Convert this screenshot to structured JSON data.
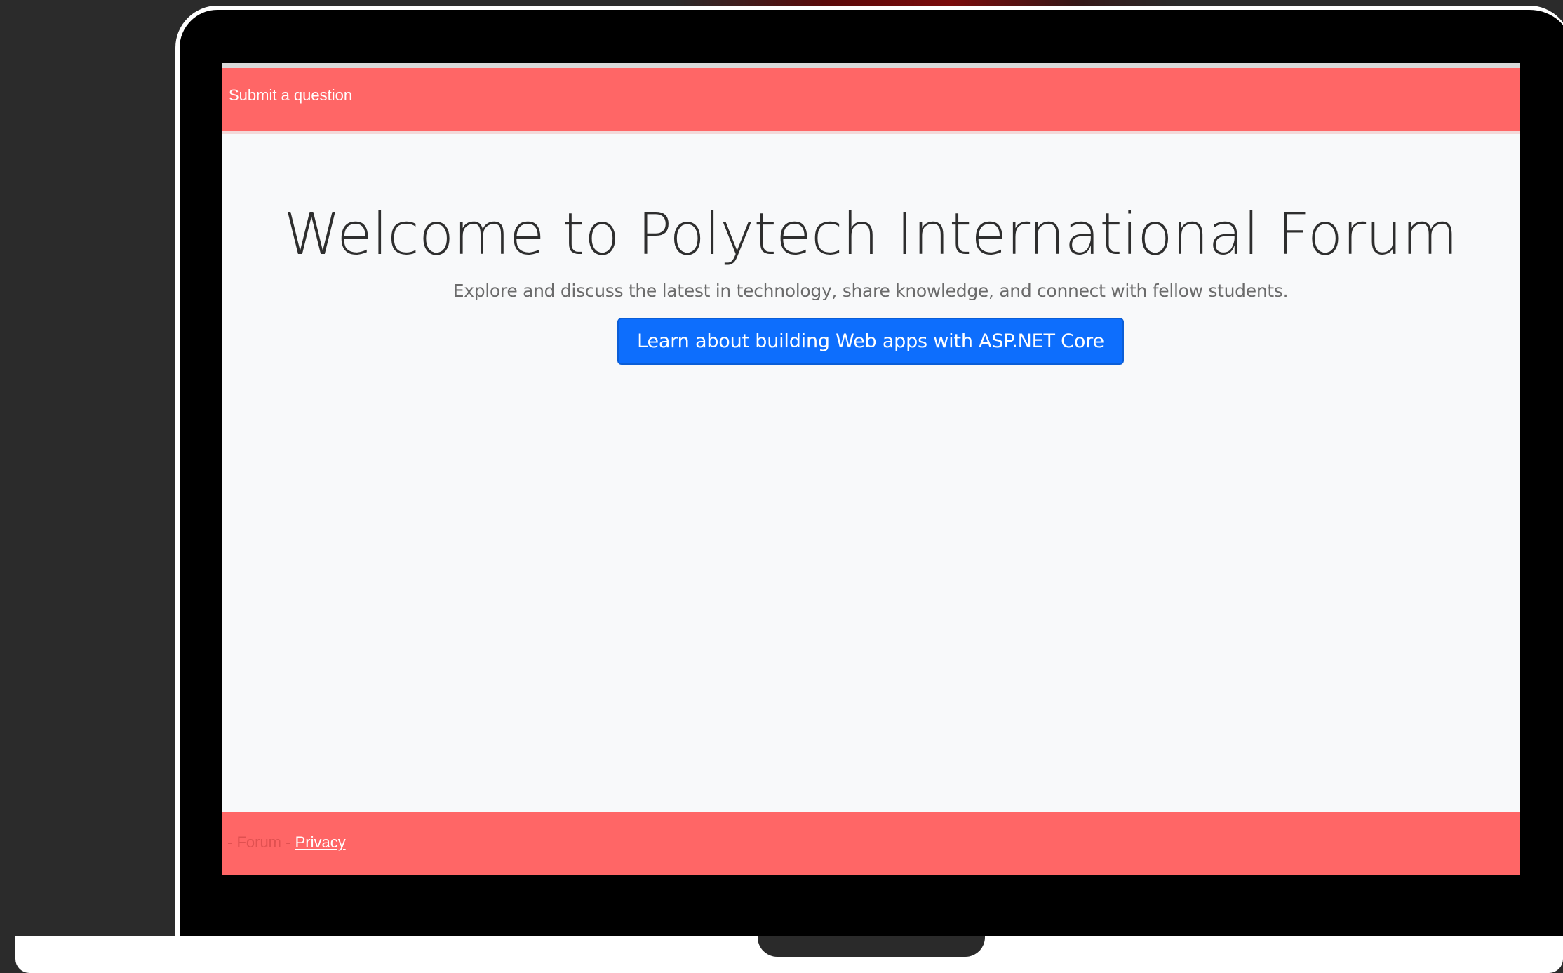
{
  "navbar": {
    "link_label": "Submit a question"
  },
  "hero": {
    "title": "Welcome to Polytech International Forum",
    "subtitle": "Explore and discuss the latest in technology, share knowledge, and connect with fellow students.",
    "button_label": "Learn about building Web apps with ASP.NET Core"
  },
  "footer": {
    "prefix": "- Forum -",
    "privacy_label": "Privacy"
  },
  "colors": {
    "accent_red": "#ff6666",
    "button_blue": "#0d6efd",
    "page_bg": "#f8f9fa"
  }
}
